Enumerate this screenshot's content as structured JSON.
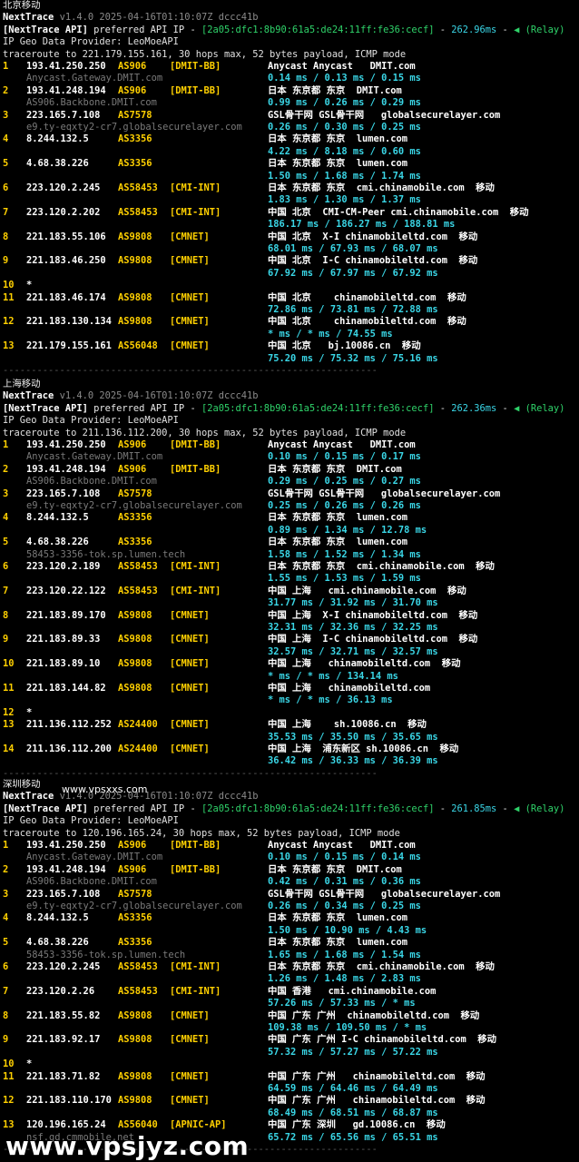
{
  "header": {
    "app": "NextTrace",
    "version": "v1.4.0 2025-04-16T01:10:07Z dccc41b",
    "api_tag": "[NextTrace API]",
    "api_text": " preferred API IP - ",
    "api_ip": "[2a05:dfc1:8b90:61a5:de24:11ff:fe36:cecf]",
    "relay": "(Relay)",
    "provider": "IP Geo Data Provider: LeoMoeAPI"
  },
  "separator": "------------------------------------------------------------------",
  "sections": [
    {
      "region": "北京移动",
      "latency": "262.96ms",
      "traceroute": "traceroute to 221.179.155.161, 30 hops max, 52 bytes payload, ICMP mode",
      "hops": [
        {
          "n": "1",
          "ip": "193.41.250.250",
          "as": "AS906",
          "tag": "[DMIT-BB]",
          "geo": "Anycast Anycast   DMIT.com",
          "rdns": "Anycast.Gateway.DMIT.com",
          "rtt": "0.14 ms / 0.13 ms / 0.15 ms"
        },
        {
          "n": "2",
          "ip": "193.41.248.194",
          "as": "AS906",
          "tag": "[DMIT-BB]",
          "geo": "日本 东京都 东京  DMIT.com",
          "rdns": "AS906.Backbone.DMIT.com",
          "rtt": "0.99 ms / 0.26 ms / 0.29 ms"
        },
        {
          "n": "3",
          "ip": "223.165.7.108",
          "as": "AS7578",
          "tag": "",
          "geo": "GSL骨干网 GSL骨干网   globalsecurelayer.com",
          "rdns": "e9.ty-eqxty2-cr7.globalsecurelayer.com",
          "rtt": "0.26 ms / 0.30 ms / 0.25 ms"
        },
        {
          "n": "4",
          "ip": "8.244.132.5",
          "as": "AS3356",
          "tag": "",
          "geo": "日本 东京都 东京  lumen.com",
          "rdns": "",
          "rtt": "4.22 ms / 8.18 ms / 0.60 ms"
        },
        {
          "n": "5",
          "ip": "4.68.38.226",
          "as": "AS3356",
          "tag": "",
          "geo": "日本 东京都 东京  lumen.com",
          "rdns": "",
          "rtt": "1.50 ms / 1.68 ms / 1.74 ms"
        },
        {
          "n": "6",
          "ip": "223.120.2.245",
          "as": "AS58453",
          "tag": "[CMI-INT]",
          "geo": "日本 东京都 东京  cmi.chinamobile.com  移动",
          "rdns": "",
          "rtt": "1.83 ms / 1.30 ms / 1.37 ms"
        },
        {
          "n": "7",
          "ip": "223.120.2.202",
          "as": "AS58453",
          "tag": "[CMI-INT]",
          "geo": "中国 北京  CMI-CM-Peer cmi.chinamobile.com  移动",
          "rdns": "",
          "rtt": "186.17 ms / 186.27 ms / 188.81 ms"
        },
        {
          "n": "8",
          "ip": "221.183.55.106",
          "as": "AS9808",
          "tag": "[CMNET]",
          "geo": "中国 北京  X-I chinamobileltd.com  移动",
          "rdns": "",
          "rtt": "68.01 ms / 67.93 ms / 68.07 ms"
        },
        {
          "n": "9",
          "ip": "221.183.46.250",
          "as": "AS9808",
          "tag": "[CMNET]",
          "geo": "中国 北京  I-C chinamobileltd.com  移动",
          "rdns": "",
          "rtt": "67.92 ms / 67.97 ms / 67.92 ms"
        },
        {
          "n": "10",
          "star": "*"
        },
        {
          "n": "11",
          "ip": "221.183.46.174",
          "as": "AS9808",
          "tag": "[CMNET]",
          "geo": "中国 北京    chinamobileltd.com  移动",
          "rdns": "",
          "rtt": "72.86 ms / 73.81 ms / 72.88 ms"
        },
        {
          "n": "12",
          "ip": "221.183.130.134",
          "as": "AS9808",
          "tag": "[CMNET]",
          "geo": "中国 北京    chinamobileltd.com  移动",
          "rdns": "",
          "rtt": "* ms / * ms / 74.55 ms"
        },
        {
          "n": "13",
          "ip": "221.179.155.161",
          "as": "AS56048",
          "tag": "[CMNET]",
          "geo": "中国 北京   bj.10086.cn  移动",
          "rdns": "",
          "rtt": "75.20 ms / 75.32 ms / 75.16 ms"
        }
      ]
    },
    {
      "region": "上海移动",
      "latency": "262.36ms",
      "traceroute": "traceroute to 211.136.112.200, 30 hops max, 52 bytes payload, ICMP mode",
      "hops": [
        {
          "n": "1",
          "ip": "193.41.250.250",
          "as": "AS906",
          "tag": "[DMIT-BB]",
          "geo": "Anycast Anycast   DMIT.com",
          "rdns": "Anycast.Gateway.DMIT.com",
          "rtt": "0.10 ms / 0.15 ms / 0.17 ms"
        },
        {
          "n": "2",
          "ip": "193.41.248.194",
          "as": "AS906",
          "tag": "[DMIT-BB]",
          "geo": "日本 东京都 东京  DMIT.com",
          "rdns": "AS906.Backbone.DMIT.com",
          "rtt": "0.29 ms / 0.25 ms / 0.27 ms"
        },
        {
          "n": "3",
          "ip": "223.165.7.108",
          "as": "AS7578",
          "tag": "",
          "geo": "GSL骨干网 GSL骨干网   globalsecurelayer.com",
          "rdns": "e9.ty-eqxty2-cr7.globalsecurelayer.com",
          "rtt": "0.25 ms / 0.26 ms / 0.26 ms"
        },
        {
          "n": "4",
          "ip": "8.244.132.5",
          "as": "AS3356",
          "tag": "",
          "geo": "日本 东京都 东京  lumen.com",
          "rdns": "",
          "rtt": "0.89 ms / 1.34 ms / 12.78 ms"
        },
        {
          "n": "5",
          "ip": "4.68.38.226",
          "as": "AS3356",
          "tag": "",
          "geo": "日本 东京都 东京  lumen.com",
          "rdns": "58453-3356-tok.sp.lumen.tech",
          "rtt": "1.58 ms / 1.52 ms / 1.34 ms"
        },
        {
          "n": "6",
          "ip": "223.120.2.189",
          "as": "AS58453",
          "tag": "[CMI-INT]",
          "geo": "日本 东京都 东京  cmi.chinamobile.com  移动",
          "rdns": "",
          "rtt": "1.55 ms / 1.53 ms / 1.59 ms"
        },
        {
          "n": "7",
          "ip": "223.120.22.122",
          "as": "AS58453",
          "tag": "[CMI-INT]",
          "geo": "中国 上海   cmi.chinamobile.com  移动",
          "rdns": "",
          "rtt": "31.77 ms / 31.92 ms / 31.70 ms"
        },
        {
          "n": "8",
          "ip": "221.183.89.170",
          "as": "AS9808",
          "tag": "[CMNET]",
          "geo": "中国 上海  X-I chinamobileltd.com  移动",
          "rdns": "",
          "rtt": "32.31 ms / 32.36 ms / 32.25 ms"
        },
        {
          "n": "9",
          "ip": "221.183.89.33",
          "as": "AS9808",
          "tag": "[CMNET]",
          "geo": "中国 上海  I-C chinamobileltd.com  移动",
          "rdns": "",
          "rtt": "32.57 ms / 32.71 ms / 32.57 ms"
        },
        {
          "n": "10",
          "ip": "221.183.89.10",
          "as": "AS9808",
          "tag": "[CMNET]",
          "geo": "中国 上海   chinamobileltd.com  移动",
          "rdns": "",
          "rtt": "* ms / * ms / 134.14 ms"
        },
        {
          "n": "11",
          "ip": "221.183.144.82",
          "as": "AS9808",
          "tag": "[CMNET]",
          "geo": "中国 上海   chinamobileltd.com",
          "rdns": "",
          "rtt": "* ms / * ms / 36.13 ms"
        },
        {
          "n": "12",
          "star": "*"
        },
        {
          "n": "13",
          "ip": "211.136.112.252",
          "as": "AS24400",
          "tag": "[CMNET]",
          "geo": "中国 上海    sh.10086.cn  移动",
          "rdns": "",
          "rtt": "35.53 ms / 35.50 ms / 35.65 ms"
        },
        {
          "n": "14",
          "ip": "211.136.112.200",
          "as": "AS24400",
          "tag": "[CMNET]",
          "geo": "中国 上海  浦东新区 sh.10086.cn  移动",
          "rdns": "",
          "rtt": "36.42 ms / 36.33 ms / 36.39 ms"
        }
      ]
    },
    {
      "region": "深圳移动",
      "latency": "261.85ms",
      "traceroute": "traceroute to 120.196.165.24, 30 hops max, 52 bytes payload, ICMP mode",
      "hops": [
        {
          "n": "1",
          "ip": "193.41.250.250",
          "as": "AS906",
          "tag": "[DMIT-BB]",
          "geo": "Anycast Anycast   DMIT.com",
          "rdns": "Anycast.Gateway.DMIT.com",
          "rtt": "0.10 ms / 0.15 ms / 0.14 ms"
        },
        {
          "n": "2",
          "ip": "193.41.248.194",
          "as": "AS906",
          "tag": "[DMIT-BB]",
          "geo": "日本 东京都 东京  DMIT.com",
          "rdns": "AS906.Backbone.DMIT.com",
          "rtt": "0.42 ms / 0.31 ms / 0.36 ms"
        },
        {
          "n": "3",
          "ip": "223.165.7.108",
          "as": "AS7578",
          "tag": "",
          "geo": "GSL骨干网 GSL骨干网   globalsecurelayer.com",
          "rdns": "e9.ty-eqxty2-cr7.globalsecurelayer.com",
          "rtt": "0.26 ms / 0.34 ms / 0.25 ms"
        },
        {
          "n": "4",
          "ip": "8.244.132.5",
          "as": "AS3356",
          "tag": "",
          "geo": "日本 东京都 东京  lumen.com",
          "rdns": "",
          "rtt": "1.50 ms / 10.90 ms / 4.43 ms"
        },
        {
          "n": "5",
          "ip": "4.68.38.226",
          "as": "AS3356",
          "tag": "",
          "geo": "日本 东京都 东京  lumen.com",
          "rdns": "58453-3356-tok.sp.lumen.tech",
          "rtt": "1.65 ms / 1.68 ms / 1.54 ms"
        },
        {
          "n": "6",
          "ip": "223.120.2.245",
          "as": "AS58453",
          "tag": "[CMI-INT]",
          "geo": "日本 东京都 东京  cmi.chinamobile.com  移动",
          "rdns": "",
          "rtt": "1.26 ms / 1.48 ms / 2.83 ms"
        },
        {
          "n": "7",
          "ip": "223.120.2.26",
          "as": "AS58453",
          "tag": "[CMI-INT]",
          "geo": "中国 香港   cmi.chinamobile.com",
          "rdns": "",
          "rtt": "57.26 ms / 57.33 ms / * ms"
        },
        {
          "n": "8",
          "ip": "221.183.55.82",
          "as": "AS9808",
          "tag": "[CMNET]",
          "geo": "中国 广东 广州  chinamobileltd.com  移动",
          "rdns": "",
          "rtt": "109.38 ms / 109.50 ms / * ms"
        },
        {
          "n": "9",
          "ip": "221.183.92.17",
          "as": "AS9808",
          "tag": "[CMNET]",
          "geo": "中国 广东 广州 I-C chinamobileltd.com  移动",
          "rdns": "",
          "rtt": "57.32 ms / 57.27 ms / 57.22 ms"
        },
        {
          "n": "10",
          "star": "*"
        },
        {
          "n": "11",
          "ip": "221.183.71.82",
          "as": "AS9808",
          "tag": "[CMNET]",
          "geo": "中国 广东 广州   chinamobileltd.com  移动",
          "rdns": "",
          "rtt": "64.59 ms / 64.46 ms / 64.49 ms"
        },
        {
          "n": "12",
          "ip": "221.183.110.170",
          "as": "AS9808",
          "tag": "[CMNET]",
          "geo": "中国 广东 广州   chinamobileltd.com  移动",
          "rdns": "",
          "rtt": "68.49 ms / 68.51 ms / 68.87 ms"
        },
        {
          "n": "13",
          "ip": "120.196.165.24",
          "as": "AS56040",
          "tag": "[APNIC-AP]",
          "geo": "中国 广东 深圳   gd.10086.cn  移动",
          "rdns": "nsf.gd.cmmobile.net",
          "rtt": "65.72 ms / 65.56 ms / 65.51 ms"
        }
      ]
    }
  ],
  "watermark_small": "www.vpsxxs.com",
  "watermark_large": "www.vpsjyz.com"
}
